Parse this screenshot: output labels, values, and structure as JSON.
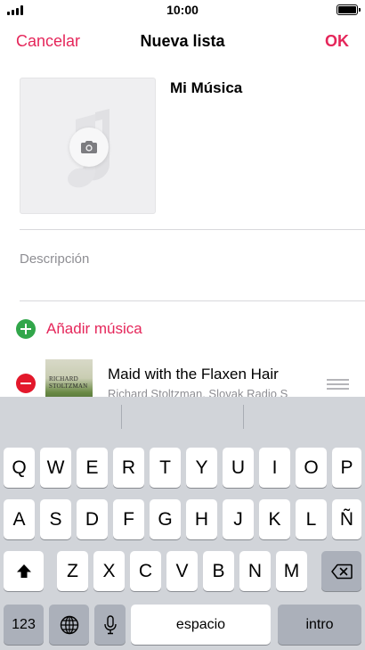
{
  "status_bar": {
    "time": "10:00"
  },
  "nav": {
    "cancel_label": "Cancelar",
    "title": "Nueva lista",
    "ok_label": "OK"
  },
  "playlist": {
    "name": "Mi Música",
    "description_placeholder": "Descripción"
  },
  "add_music": {
    "label": "Añadir música"
  },
  "tracks": [
    {
      "title": "Maid with the Flaxen Hair",
      "artist": "Richard Stoltzman, Slovak Radio S",
      "album_art_text": [
        "RICHARD",
        "STOLTZMAN"
      ]
    }
  ],
  "keyboard": {
    "row1": [
      "Q",
      "W",
      "E",
      "R",
      "T",
      "Y",
      "U",
      "I",
      "O",
      "P"
    ],
    "row2": [
      "A",
      "S",
      "D",
      "F",
      "G",
      "H",
      "J",
      "K",
      "L",
      "Ñ"
    ],
    "row3": [
      "Z",
      "X",
      "C",
      "V",
      "B",
      "N",
      "M"
    ],
    "numbers_label": "123",
    "space_label": "espacio",
    "return_label": "intro"
  },
  "colors": {
    "accent": "#e5265a",
    "add": "#31a64a",
    "remove": "#e3182b",
    "keyboard_bg": "#d1d4d9"
  },
  "icons": [
    "signal-icon",
    "battery-icon",
    "music-note-icon",
    "camera-icon",
    "add-icon",
    "remove-icon",
    "drag-handle-icon",
    "shift-icon",
    "delete-icon",
    "globe-icon",
    "microphone-icon"
  ]
}
